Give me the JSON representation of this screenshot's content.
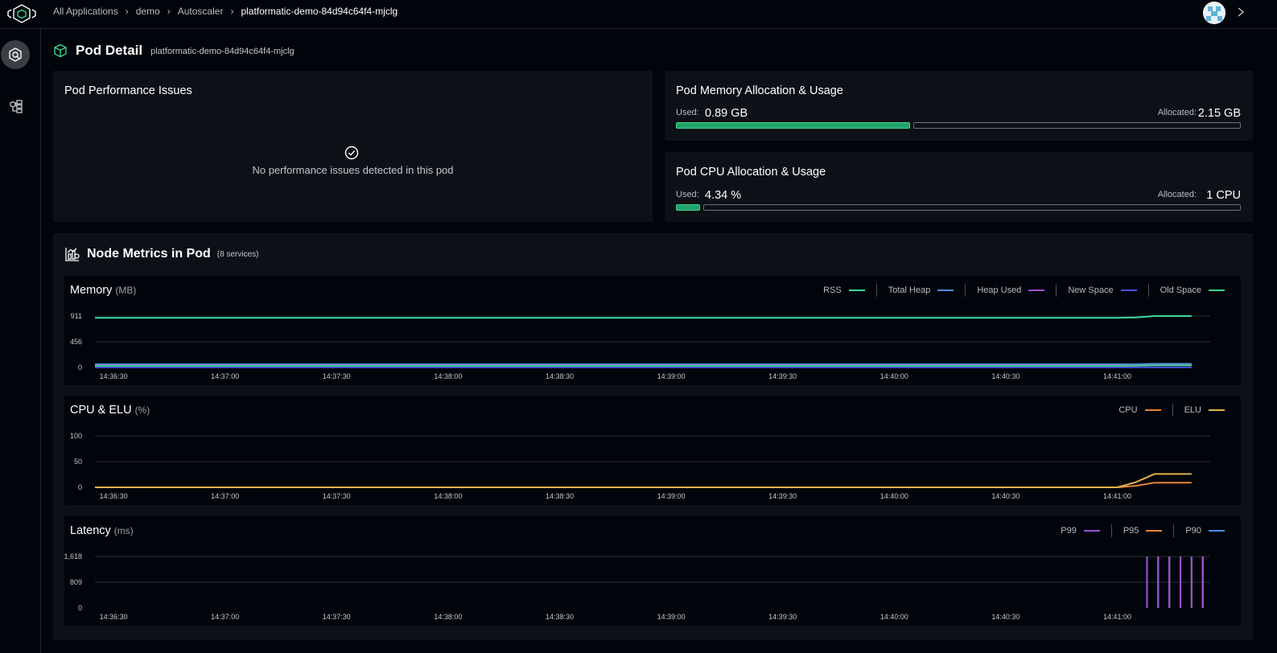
{
  "breadcrumb": {
    "items": [
      "All Applications",
      "demo",
      "Autoscaler",
      "platformatic-demo-84d94c64f4-mjclg"
    ]
  },
  "page": {
    "title": "Pod Detail",
    "pod_name": "platformatic-demo-84d94c64f4-mjclg"
  },
  "performance": {
    "title": "Pod Performance Issues",
    "empty_message": "No performance issues detected in this pod"
  },
  "memory": {
    "title": "Pod Memory Allocation & Usage",
    "used_label": "Used:",
    "used_value": "0.89 GB",
    "allocated_label": "Allocated:",
    "allocated_value": "2.15 GB",
    "usage_fraction": 0.414
  },
  "cpu": {
    "title": "Pod CPU Allocation & Usage",
    "used_label": "Used:",
    "used_value": "4.34 %",
    "allocated_label": "Allocated:",
    "allocated_value": "1 CPU",
    "usage_fraction": 0.0434
  },
  "metrics": {
    "title": "Node Metrics in Pod",
    "subtitle": "(8 services)"
  },
  "colors": {
    "accent_green": "#3dd68c",
    "rss": "#3dd6a0",
    "total_heap": "#4a90e2",
    "heap_used": "#9b4fd6",
    "new_space": "#4a50e8",
    "old_space": "#3dd68c",
    "cpu": "#e8833a",
    "elu": "#e8b04a",
    "p99": "#9b4fd6",
    "p95": "#e8833a",
    "p90": "#4a90e2"
  },
  "chart_data": [
    {
      "type": "line",
      "title": "Memory",
      "unit": "(MB)",
      "x_ticks": [
        "14:36:30",
        "14:37:00",
        "14:37:30",
        "14:38:00",
        "14:38:30",
        "14:39:00",
        "14:39:30",
        "14:40:00",
        "14:40:30",
        "14:41:00"
      ],
      "y_ticks": [
        "911",
        "456",
        "0"
      ],
      "ylim": [
        0,
        911
      ],
      "x": [
        "14:36:25",
        "14:41:00",
        "14:41:05",
        "14:41:10",
        "14:41:20"
      ],
      "series": [
        {
          "name": "RSS",
          "color": "#3dd6a0",
          "values": [
            880,
            880,
            885,
            911,
            911
          ]
        },
        {
          "name": "Total Heap",
          "color": "#4a90e2",
          "values": [
            58,
            58,
            58,
            66,
            66
          ]
        },
        {
          "name": "Heap Used",
          "color": "#9b4fd6",
          "values": [
            38,
            38,
            40,
            45,
            45
          ]
        },
        {
          "name": "New Space",
          "color": "#4a50e8",
          "values": [
            4,
            4,
            4,
            4,
            4
          ]
        },
        {
          "name": "Old Space",
          "color": "#3dd68c",
          "values": [
            30,
            30,
            32,
            38,
            38
          ]
        }
      ]
    },
    {
      "type": "line",
      "title": "CPU & ELU",
      "unit": "(%)",
      "x_ticks": [
        "14:36:30",
        "14:37:00",
        "14:37:30",
        "14:38:00",
        "14:38:30",
        "14:39:00",
        "14:39:30",
        "14:40:00",
        "14:40:30",
        "14:41:00"
      ],
      "y_ticks": [
        "100",
        "50",
        "0"
      ],
      "ylim": [
        0,
        100
      ],
      "x": [
        "14:36:25",
        "14:41:00",
        "14:41:05",
        "14:41:10",
        "14:41:20"
      ],
      "series": [
        {
          "name": "CPU",
          "color": "#e8833a",
          "values": [
            0,
            0,
            3,
            9,
            9
          ]
        },
        {
          "name": "ELU",
          "color": "#e8b04a",
          "values": [
            0,
            0,
            10,
            26,
            26
          ]
        }
      ]
    },
    {
      "type": "line",
      "title": "Latency",
      "unit": "(ms)",
      "x_ticks": [
        "14:36:30",
        "14:37:00",
        "14:37:30",
        "14:38:00",
        "14:38:30",
        "14:39:00",
        "14:39:30",
        "14:40:00",
        "14:40:30",
        "14:41:00"
      ],
      "y_ticks": [
        "1,618",
        "809",
        "0"
      ],
      "ylim": [
        0,
        1618
      ],
      "spike_times": [
        "14:41:08",
        "14:41:11",
        "14:41:14",
        "14:41:17",
        "14:41:20",
        "14:41:23"
      ],
      "series": [
        {
          "name": "P99",
          "color": "#9b4fd6",
          "values": [
            1618,
            1618,
            1618,
            1618,
            1618,
            1618
          ]
        },
        {
          "name": "P95",
          "color": "#e8833a",
          "values": [
            1618,
            1618,
            1618,
            1618,
            1618,
            1618
          ]
        },
        {
          "name": "P90",
          "color": "#4a90e2",
          "values": [
            1618,
            1618,
            1618,
            1618,
            1618,
            1618
          ]
        }
      ]
    }
  ]
}
